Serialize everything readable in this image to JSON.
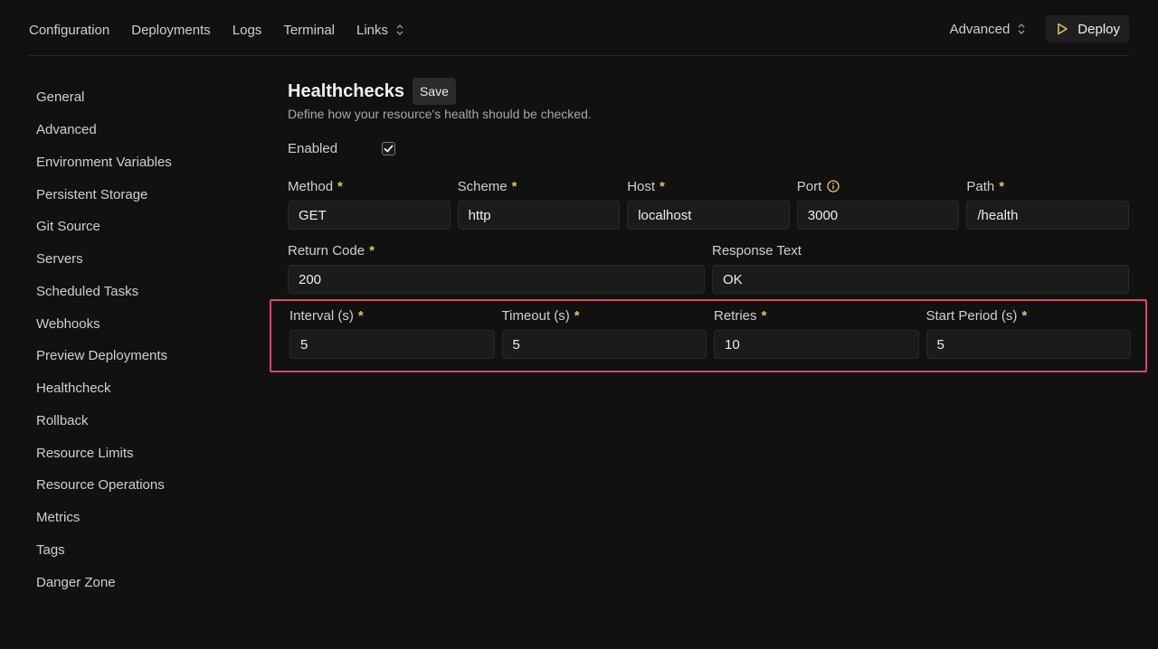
{
  "nav": {
    "items": [
      "Configuration",
      "Deployments",
      "Logs",
      "Terminal"
    ],
    "links_label": "Links",
    "advanced_label": "Advanced",
    "deploy_label": "Deploy"
  },
  "sidebar": {
    "items": [
      "General",
      "Advanced",
      "Environment Variables",
      "Persistent Storage",
      "Git Source",
      "Servers",
      "Scheduled Tasks",
      "Webhooks",
      "Preview Deployments",
      "Healthcheck",
      "Rollback",
      "Resource Limits",
      "Resource Operations",
      "Metrics",
      "Tags",
      "Danger Zone"
    ]
  },
  "main": {
    "title": "Healthchecks",
    "save_label": "Save",
    "subtitle": "Define how your resource's health should be checked.",
    "enabled_label": "Enabled",
    "enabled_checked": true,
    "fields": {
      "method": {
        "label": "Method",
        "value": "GET"
      },
      "scheme": {
        "label": "Scheme",
        "value": "http"
      },
      "host": {
        "label": "Host",
        "value": "localhost"
      },
      "port": {
        "label": "Port",
        "value": "3000"
      },
      "path": {
        "label": "Path",
        "value": "/health"
      },
      "return_code": {
        "label": "Return Code",
        "value": "200"
      },
      "response_text": {
        "label": "Response Text",
        "value": "OK"
      },
      "interval": {
        "label": "Interval (s)",
        "value": "5"
      },
      "timeout": {
        "label": "Timeout (s)",
        "value": "5"
      },
      "retries": {
        "label": "Retries",
        "value": "10"
      },
      "start_period": {
        "label": "Start Period (s)",
        "value": "5"
      }
    },
    "required_marker": "*"
  },
  "colors": {
    "background": "#111111",
    "accent_required": "#e6c45a",
    "highlight_border": "#d54a6a"
  }
}
